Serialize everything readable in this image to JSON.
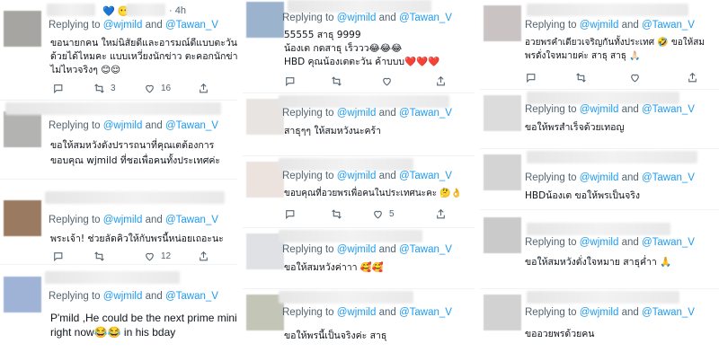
{
  "reply_prefix": "Replying to",
  "reply_mid": "and",
  "mention_1": "@wjmild",
  "mention_2": "@Tawan_V",
  "col_a": {
    "t1": {
      "meta_emoji": "💙 😶",
      "time": "· 4h",
      "lines": [
        "ขอนายกคน ใหม่นิสัยดีและอารมณ์ดีแบบตะวัน",
        "ด้วยได้ไหมคะ แบบเหวี่ยงนักข่าว ตะคอกนักข่า",
        "ไม่ไหวจริงๆ 😊😌"
      ],
      "retweets": "3",
      "likes": "16"
    },
    "t2": {
      "lines": [
        "ขอให้สมหวังดังปรารถนาที่คุณเตต้องการ",
        "ขอบคุณ wjmild ที่ชอเพื่อคนทั้งประเทศค่ะ"
      ]
    },
    "t3": {
      "lines": [
        "พระเจ้า! ช่วยลัดคิวให้กับพรนี้หน่อยเถอะนะ"
      ],
      "likes": "12"
    },
    "t4": {
      "lines": [
        "P'mild ,He could be the next prime minist",
        "right now😂😂 in his bday"
      ]
    }
  },
  "col_b": {
    "t1": {
      "lines": [
        "55555 สาธุ 9999",
        "น้องเต กดสาธุ เร็ววว😂😂😂",
        "HBD คุณน้องเตตะวัน ค้าบบบ❤️❤️❤️"
      ]
    },
    "t2": {
      "lines": [
        "สาธุๆๆ ให้สมหวังนะคร้า"
      ]
    },
    "t3": {
      "lines": [
        "ขอบคุณที่อวยพรเพื่อคนในประเทศนะคะ 🤔👌"
      ],
      "likes": "5"
    },
    "t4": {
      "lines": [
        "ขอให้สมหวังค่าาา 🥰🥰"
      ]
    },
    "t5": {
      "lines": [
        "ขอให้พรนี้เป็นจริงค่ะ สาธุ"
      ]
    }
  },
  "col_c": {
    "t1": {
      "lines": [
        "อวยพรคำเดียวเจริญกันทั้งประเทศ 🤣 ขอให้สม",
        "พรดั่งใจหมายค่ะ สาธุ สาธุ 🙏🏻"
      ]
    },
    "t2": {
      "lines": [
        "ขอให้พรสำเร็จด้วยเทอญ"
      ]
    },
    "t3": {
      "lines": [
        "HBDน้องเต ขอให้พรเป็นจริง"
      ]
    },
    "t4": {
      "lines": [
        "ขอให้สมหวังดั่งใจหมาย สาธุค่ำา 🙏"
      ]
    },
    "t5": {
      "lines": [
        "ขออวยพรด้วยคน"
      ]
    }
  },
  "colors": {
    "accent": "#1d9bf0",
    "muted": "#536471",
    "text": "#0f1419",
    "divider": "#eff3f4"
  }
}
